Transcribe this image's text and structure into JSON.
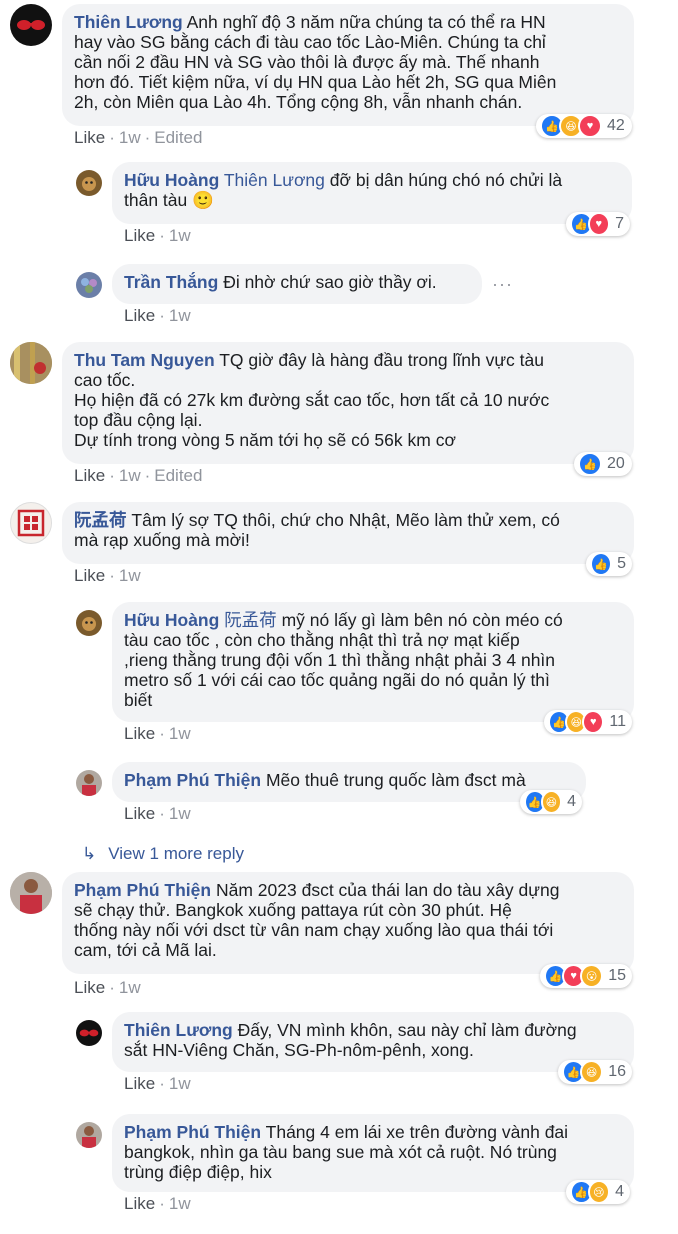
{
  "comments": [
    {
      "author": "Thiên Lương",
      "text": "Anh nghĩ độ 3 năm nữa chúng ta có thể ra HN\nhay vào SG bằng cách đi tàu cao tốc Lào-Miên. Chúng ta chỉ\ncần nối 2 đầu HN và SG vào thôi là được ấy mà. Thế nhanh\nhơn đó. Tiết kiệm nữa, ví dụ HN qua Lào hết 2h, SG qua Miên\n2h, còn Miên qua Lào 4h. Tổng cộng 8h, vẫn nhanh chán.",
      "like": "Like",
      "time": "1w",
      "edited": "Edited",
      "reaction_count": "42"
    },
    {
      "author": "Hữu Hoàng",
      "mention": "Thiên Lương",
      "text": "đỡ bị dân húng chó nó chửi là\nthân tàu 🙂",
      "like": "Like",
      "time": "1w",
      "reaction_count": "7"
    },
    {
      "author": "Trần Thắng",
      "text": "Đi nhờ chứ sao giờ thầy ơi.",
      "like": "Like",
      "time": "1w",
      "more": "···"
    },
    {
      "author": "Thu Tam Nguyen",
      "text": "TQ giờ đây là hàng đầu trong lĩnh vực tàu\ncao tốc.\nHọ hiện đã có 27k km đường sắt cao tốc, hơn tất cả 10 nước\ntop đầu cộng lại.\nDự tính trong vòng 5 năm tới họ sẽ có 56k km cơ",
      "like": "Like",
      "time": "1w",
      "edited": "Edited",
      "reaction_count": "20"
    },
    {
      "author": "阮孟荷",
      "text": "Tâm lý sợ TQ thôi, chứ cho Nhật, Mẽo làm thử xem, có\nmà rạp xuống mà mời!",
      "like": "Like",
      "time": "1w",
      "reaction_count": "5"
    },
    {
      "author": "Hữu Hoàng",
      "mention": "阮孟荷",
      "text": "mỹ nó lấy gì làm bên nó còn méo có\ntàu cao tốc , còn cho thằng nhật thì trả nợ mạt kiếp\n,rieng thằng trung đội vốn 1 thì thằng nhật phải 3 4 nhìn\nmetro số 1 với cái cao tốc quảng ngãi do nó quản lý thì\nbiết",
      "like": "Like",
      "time": "1w",
      "reaction_count": "11"
    },
    {
      "author": "Phạm Phú Thiện",
      "text": "Mẽo thuê trung quốc làm đsct mà",
      "like": "Like",
      "time": "1w",
      "reaction_count": "4"
    },
    {
      "author": "Phạm Phú Thiện",
      "text": "Năm 2023 đsct của thái lan do tàu xây dựng\nsẽ chạy thử. Bangkok xuống pattaya rút còn 30 phút. Hệ\nthống này nối với dsct từ vân nam chạy xuống lào qua thái tới\ncam, tới cả Mã lai.",
      "like": "Like",
      "time": "1w",
      "reaction_count": "15"
    },
    {
      "author": "Thiên Lương",
      "text": "Đấy, VN mình khôn, sau này chỉ làm đường\nsắt HN-Viêng Chăn, SG-Ph-nôm-pênh, xong.",
      "like": "Like",
      "time": "1w",
      "reaction_count": "16"
    },
    {
      "author": "Phạm Phú Thiện",
      "text": "Tháng 4 em lái xe trên đường vành đai\nbangkok, nhìn ga tàu bang sue mà xót cả ruột. Nó trùng\ntrùng điệp điệp, hix",
      "like": "Like",
      "time": "1w",
      "reaction_count": "4"
    }
  ],
  "view_more_replies": "View 1 more reply",
  "view_more_icon": "↳",
  "colors": {
    "link": "#385898",
    "bubble": "#f2f3f5",
    "meta": "#90949c",
    "like_reaction": "#2078f4",
    "love_reaction": "#f33e58",
    "haha_reaction": "#f7b125"
  }
}
